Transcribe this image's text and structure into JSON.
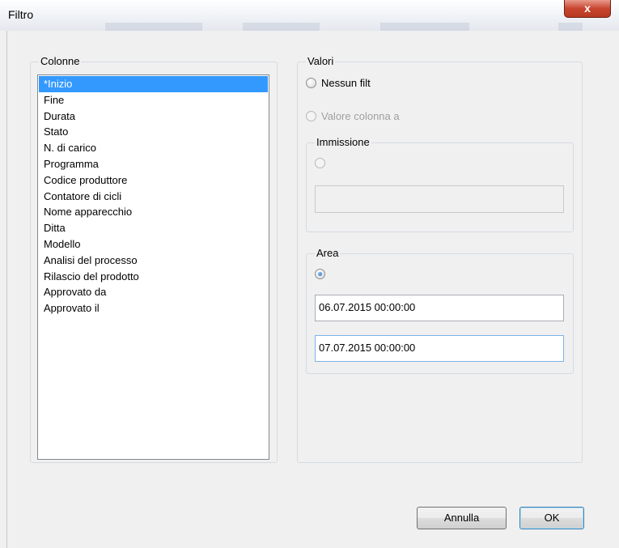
{
  "window": {
    "title": "Filtro",
    "close_label": "x"
  },
  "columns": {
    "legend": "Colonne",
    "items": [
      "*Inizio",
      "Fine",
      "Durata",
      "Stato",
      "N. di carico",
      "Programma",
      "Codice produttore",
      "Contatore di cicli",
      "Nome apparecchio",
      "Ditta",
      "Modello",
      "Analisi del processo",
      "Rilascio del prodotto",
      "Approvato da",
      "Approvato il"
    ],
    "selected_index": 0
  },
  "values": {
    "legend": "Valori",
    "no_filter_label": "Nessun filt",
    "column_value_label": "Valore colonna a",
    "entry": {
      "legend": "Immissione",
      "value": ""
    },
    "area": {
      "legend": "Area",
      "from_value": "06.07.2015 00:00:00",
      "to_value": "07.07.2015 00:00:00"
    }
  },
  "buttons": {
    "cancel_label": "Annulla",
    "ok_label": "OK"
  }
}
